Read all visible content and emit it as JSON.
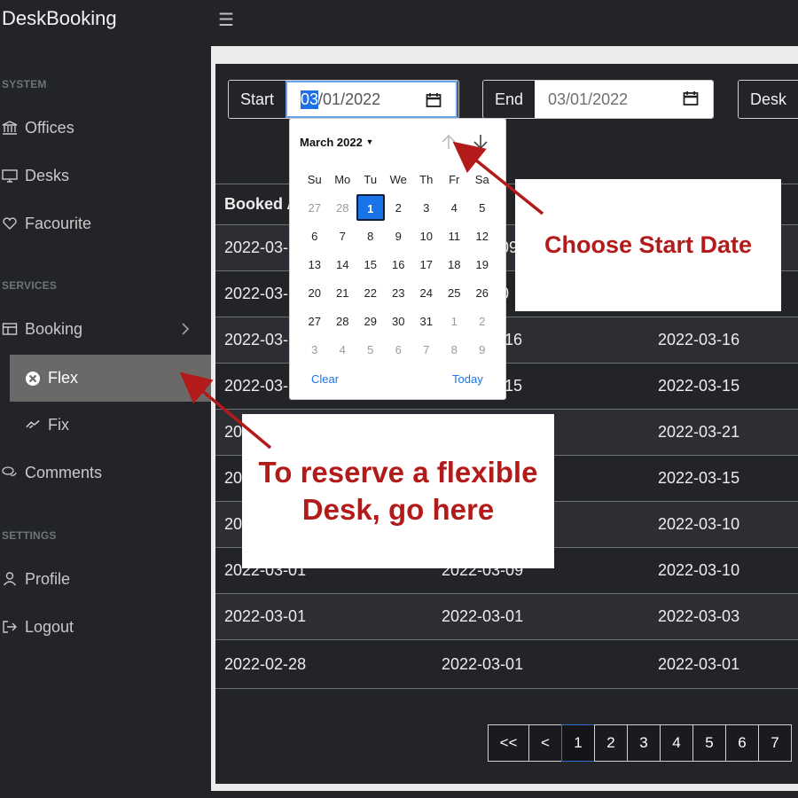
{
  "app": {
    "title": "DeskBooking"
  },
  "sidebar": {
    "sections": [
      {
        "title": "SYSTEM",
        "items": [
          {
            "label": "Offices",
            "icon": "bank-icon"
          },
          {
            "label": "Desks",
            "icon": "monitor-icon"
          },
          {
            "label": "Facourite",
            "icon": "heart-icon"
          }
        ]
      },
      {
        "title": "SERVICES",
        "items": [
          {
            "label": "Booking",
            "icon": "table-icon"
          },
          {
            "label": "Flex",
            "icon": "circle-x-icon",
            "active": true
          },
          {
            "label": "Fix",
            "icon": "pin-icon"
          },
          {
            "label": "Comments",
            "icon": "comments-icon"
          }
        ]
      },
      {
        "title": "SETTINGS",
        "items": [
          {
            "label": "Profile",
            "icon": "user-icon"
          },
          {
            "label": "Logout",
            "icon": "logout-icon"
          }
        ]
      }
    ]
  },
  "filters": {
    "start": {
      "label": "Start",
      "month": "03",
      "rest": "/01/2022"
    },
    "end": {
      "label": "End",
      "value": "03/01/2022"
    },
    "desk": {
      "label": "Desk"
    }
  },
  "datepicker": {
    "month_label": "March 2022",
    "weekdays": [
      "Su",
      "Mo",
      "Tu",
      "We",
      "Th",
      "Fr",
      "Sa"
    ],
    "weeks": [
      [
        "27",
        "28",
        "1",
        "2",
        "3",
        "4",
        "5"
      ],
      [
        "6",
        "7",
        "8",
        "9",
        "10",
        "11",
        "12"
      ],
      [
        "13",
        "14",
        "15",
        "16",
        "17",
        "18",
        "19"
      ],
      [
        "20",
        "21",
        "22",
        "23",
        "24",
        "25",
        "26"
      ],
      [
        "27",
        "28",
        "29",
        "30",
        "31",
        "1",
        "2"
      ],
      [
        "3",
        "4",
        "5",
        "6",
        "7",
        "8",
        "9"
      ]
    ],
    "selected": "1",
    "clear_label": "Clear",
    "today_label": "Today"
  },
  "table": {
    "header": "Booked A",
    "rows": [
      [
        "2022-03-",
        "09",
        ""
      ],
      [
        "2022-03-",
        "0",
        ""
      ],
      [
        "2022-03-",
        "16",
        "2022-03-16"
      ],
      [
        "2022-03-",
        "15",
        "2022-03-15"
      ],
      [
        "20",
        "",
        "2022-03-21"
      ],
      [
        "20",
        "",
        "2022-03-15"
      ],
      [
        "20",
        "",
        "2022-03-10"
      ],
      [
        "2022-03-01",
        "2022-03-09",
        "2022-03-10"
      ],
      [
        "2022-03-01",
        "2022-03-01",
        "2022-03-03"
      ],
      [
        "2022-02-28",
        "2022-03-01",
        "2022-03-01"
      ]
    ]
  },
  "pagination": {
    "first": "<<",
    "prev": "<",
    "pages": [
      "1",
      "2",
      "3",
      "4",
      "5",
      "6",
      "7"
    ],
    "current": "1"
  },
  "annotations": {
    "start_date": "Choose Start Date",
    "flex_line1": "To reserve a flexible",
    "flex_line2": "Desk, go here",
    "color": "#b31b1b"
  }
}
